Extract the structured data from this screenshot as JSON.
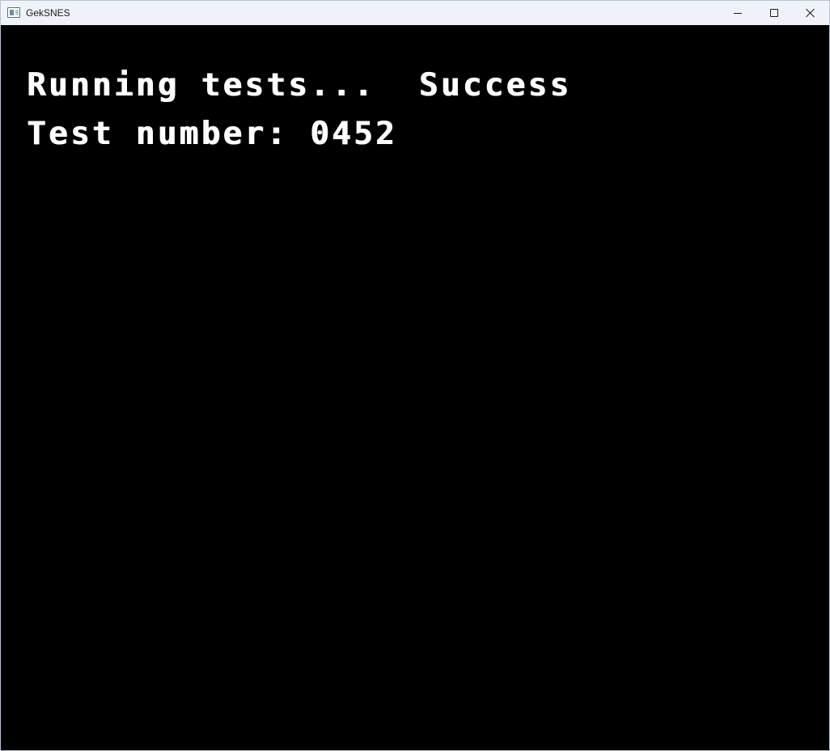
{
  "window": {
    "title": "GekSNES",
    "icon": "app-window-icon",
    "controls": {
      "minimize_icon": "minimize-icon",
      "maximize_icon": "maximize-icon",
      "close_icon": "close-icon"
    }
  },
  "screen": {
    "status_label": "Running tests...",
    "status_result": "Success",
    "test_number_label": "Test number:",
    "test_number": "0452"
  },
  "colors": {
    "screen_background": "#000000",
    "text": "#ffffff",
    "titlebar": "#eff3f9"
  }
}
